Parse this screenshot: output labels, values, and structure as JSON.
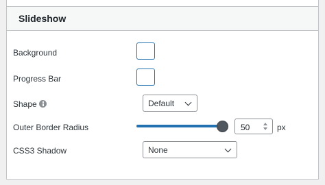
{
  "panel": {
    "title": "Slideshow"
  },
  "settings": {
    "background": {
      "label": "Background"
    },
    "progress_bar": {
      "label": "Progress Bar"
    },
    "shape": {
      "label": "Shape",
      "icon": "info-icon",
      "value": "Default"
    },
    "outer_border_radius": {
      "label": "Outer Border Radius",
      "slider_fraction": 0.96,
      "value": "50",
      "unit": "px"
    },
    "css3_shadow": {
      "label": "CSS3 Shadow",
      "value": "None"
    }
  },
  "colors": {
    "accent": "#2271b1",
    "border": "#c3c4c7"
  }
}
